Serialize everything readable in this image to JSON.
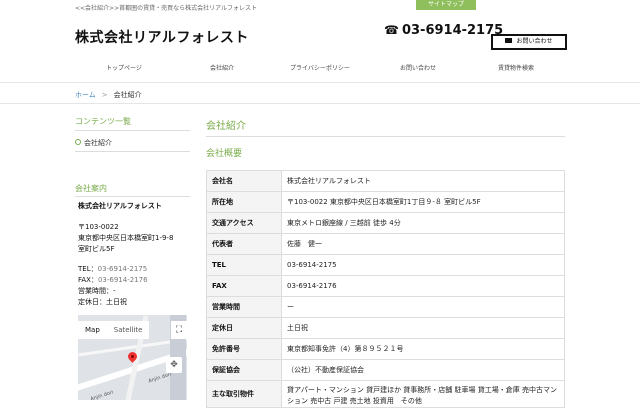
{
  "header": {
    "tagline": "<<会社紹介>>首都圏の賃貸・売買なら株式会社リアルフォレスト",
    "sitemap_label": "サイトマップ",
    "logo": "株式会社リアルフォレスト",
    "phone": "03-6914-2175",
    "contact_label": "お問い合わせ"
  },
  "nav": {
    "items": [
      "トップページ",
      "会社紹介",
      "プライバシーポリシー",
      "お問い合わせ",
      "賃貸物件検索"
    ]
  },
  "breadcrumb": {
    "home": "ホーム",
    "separator": ">",
    "current": "会社紹介"
  },
  "sidebar": {
    "contents_title": "コンテンツ一覧",
    "contents_link": "会社紹介",
    "company_title": "会社案内",
    "company_name": "株式会社リアルフォレスト",
    "postal": "〒103-0022",
    "address1": "東京都中央区日本橋室町1-9-8",
    "address2": "室町ビル5F",
    "tel_label": "TEL：",
    "tel": "03-6914-2175",
    "fax_label": "FAX：",
    "fax": "03-6914-2176",
    "hours": "営業時間：-",
    "holiday": "定休日：土日祝",
    "map": {
      "tab_map": "Map",
      "tab_satellite": "Satellite",
      "street1": "Anjin dori",
      "street2": "Anjin dori"
    }
  },
  "main": {
    "title": "会社紹介",
    "subtitle": "会社概要",
    "rows": [
      {
        "label": "会社名",
        "value": "株式会社リアルフォレスト"
      },
      {
        "label": "所在地",
        "value": "〒103-0022 東京都中央区日本橋室町1丁目９-８ 室町ビル5F"
      },
      {
        "label": "交通アクセス",
        "value": "東京メトロ銀座線 / 三越前 徒歩 4分"
      },
      {
        "label": "代表者",
        "value": "佐藤　健一"
      },
      {
        "label": "TEL",
        "value": "03-6914-2175"
      },
      {
        "label": "FAX",
        "value": "03-6914-2176"
      },
      {
        "label": "営業時間",
        "value": "ー"
      },
      {
        "label": "定休日",
        "value": "土日祝"
      },
      {
        "label": "免許番号",
        "value": "東京都知事免許（4）第８９５２１号"
      },
      {
        "label": "保証協会",
        "value": "（公社）不動産保証協会"
      },
      {
        "label": "主な取引物件",
        "value": "貸アパート・マンション 貸戸建ほか 貸事務所・店舗 駐車場 貸工場・倉庫 売中古マンション 売中古 戸建 売土地 投資用　その他"
      }
    ]
  }
}
